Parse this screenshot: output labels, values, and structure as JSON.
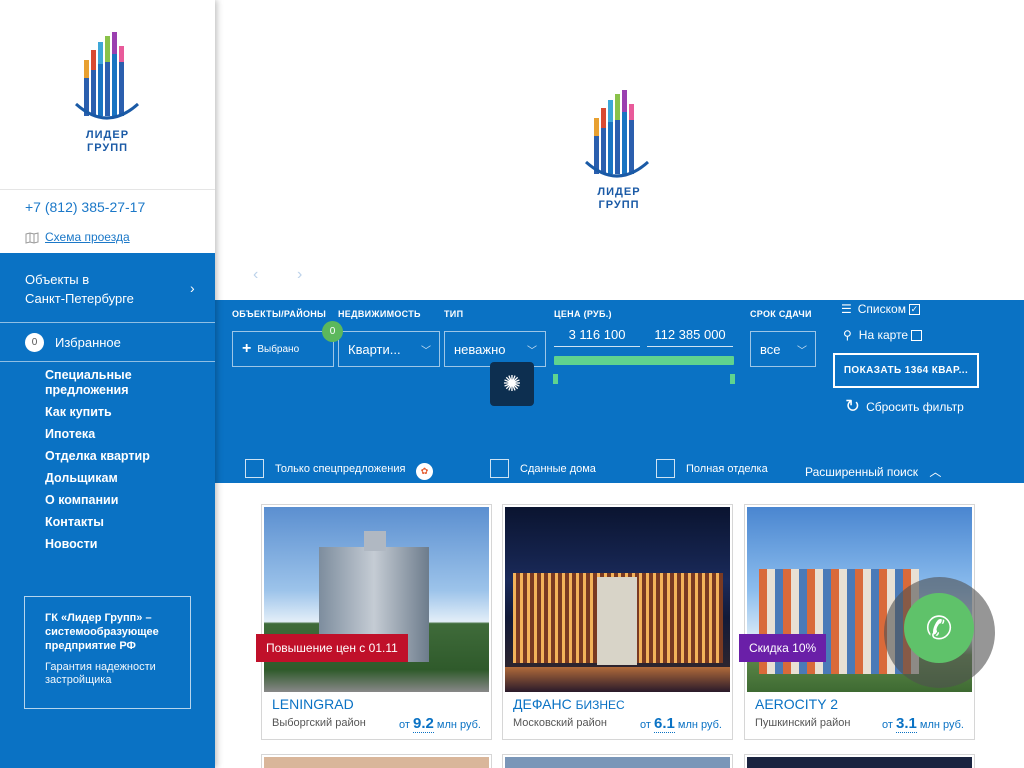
{
  "sidebar": {
    "logo_line1": "ЛИДЕР",
    "logo_line2": "ГРУПП",
    "phone": "+7 (812) 385-27-17",
    "scheme": "Схема проезда",
    "objects_line1": "Объекты в",
    "objects_line2": "Санкт-Петербурге",
    "favorites_count": "0",
    "favorites": "Избранное",
    "menu": [
      "Специальные предложения",
      "Как купить",
      "Ипотека",
      "Отделка квартир",
      "Дольщикам",
      "О компании",
      "Контакты",
      "Новости"
    ],
    "info_title": "ГК «Лидер Групп» – системообразующее предприятие РФ",
    "info_sub": "Гарантия надежности застройщика"
  },
  "banner": {
    "logo_line1": "ЛИДЕР",
    "logo_line2": "ГРУПП",
    "prev": "‹",
    "next": "›"
  },
  "filter": {
    "labels": {
      "objects": "ОБЪЕКТЫ/РАЙОНЫ",
      "realty": "НЕДВИЖИМОСТЬ",
      "type": "ТИП",
      "price": "ЦЕНА (РУБ.)",
      "deadline": "СРОК СДАЧИ"
    },
    "selected": "Выбрано",
    "selected_count": "0",
    "realty_value": "Кварти...",
    "type_value": "неважно",
    "price_min": "3 116 100",
    "price_max": "112 385 000",
    "deadline_value": "все",
    "view_list": "Списком",
    "view_map": "На карте",
    "show_button": "ПОКАЗАТЬ 1364 КВАР...",
    "reset": "Сбросить фильтр",
    "only_special": "Только спецпредложения",
    "built": "Сданные дома",
    "finish": "Полная отделка",
    "advanced": "Расширенный поиск"
  },
  "cards": [
    {
      "title": "LENINGRAD",
      "title_suffix": "",
      "district": "Выборгский район",
      "price_prefix": "от",
      "price": "9.2",
      "price_unit": "млн руб.",
      "tag": "Повышение цен с 01.11",
      "tag_color": "#c0102a"
    },
    {
      "title": "ДЕФАНС",
      "title_suffix": "БИЗНЕС",
      "district": "Московский район",
      "price_prefix": "от",
      "price": "6.1",
      "price_unit": "млн руб.",
      "tag": "",
      "tag_color": ""
    },
    {
      "title": "AEROCITY 2",
      "title_suffix": "",
      "district": "Пушкинский район",
      "price_prefix": "от",
      "price": "3.1",
      "price_unit": "млн руб.",
      "tag": "Скидка 10%",
      "tag_color": "#6a1fa8"
    }
  ],
  "colors": {
    "primary": "#0a72c4",
    "green": "#5fd38f",
    "call": "#5fc26a"
  }
}
